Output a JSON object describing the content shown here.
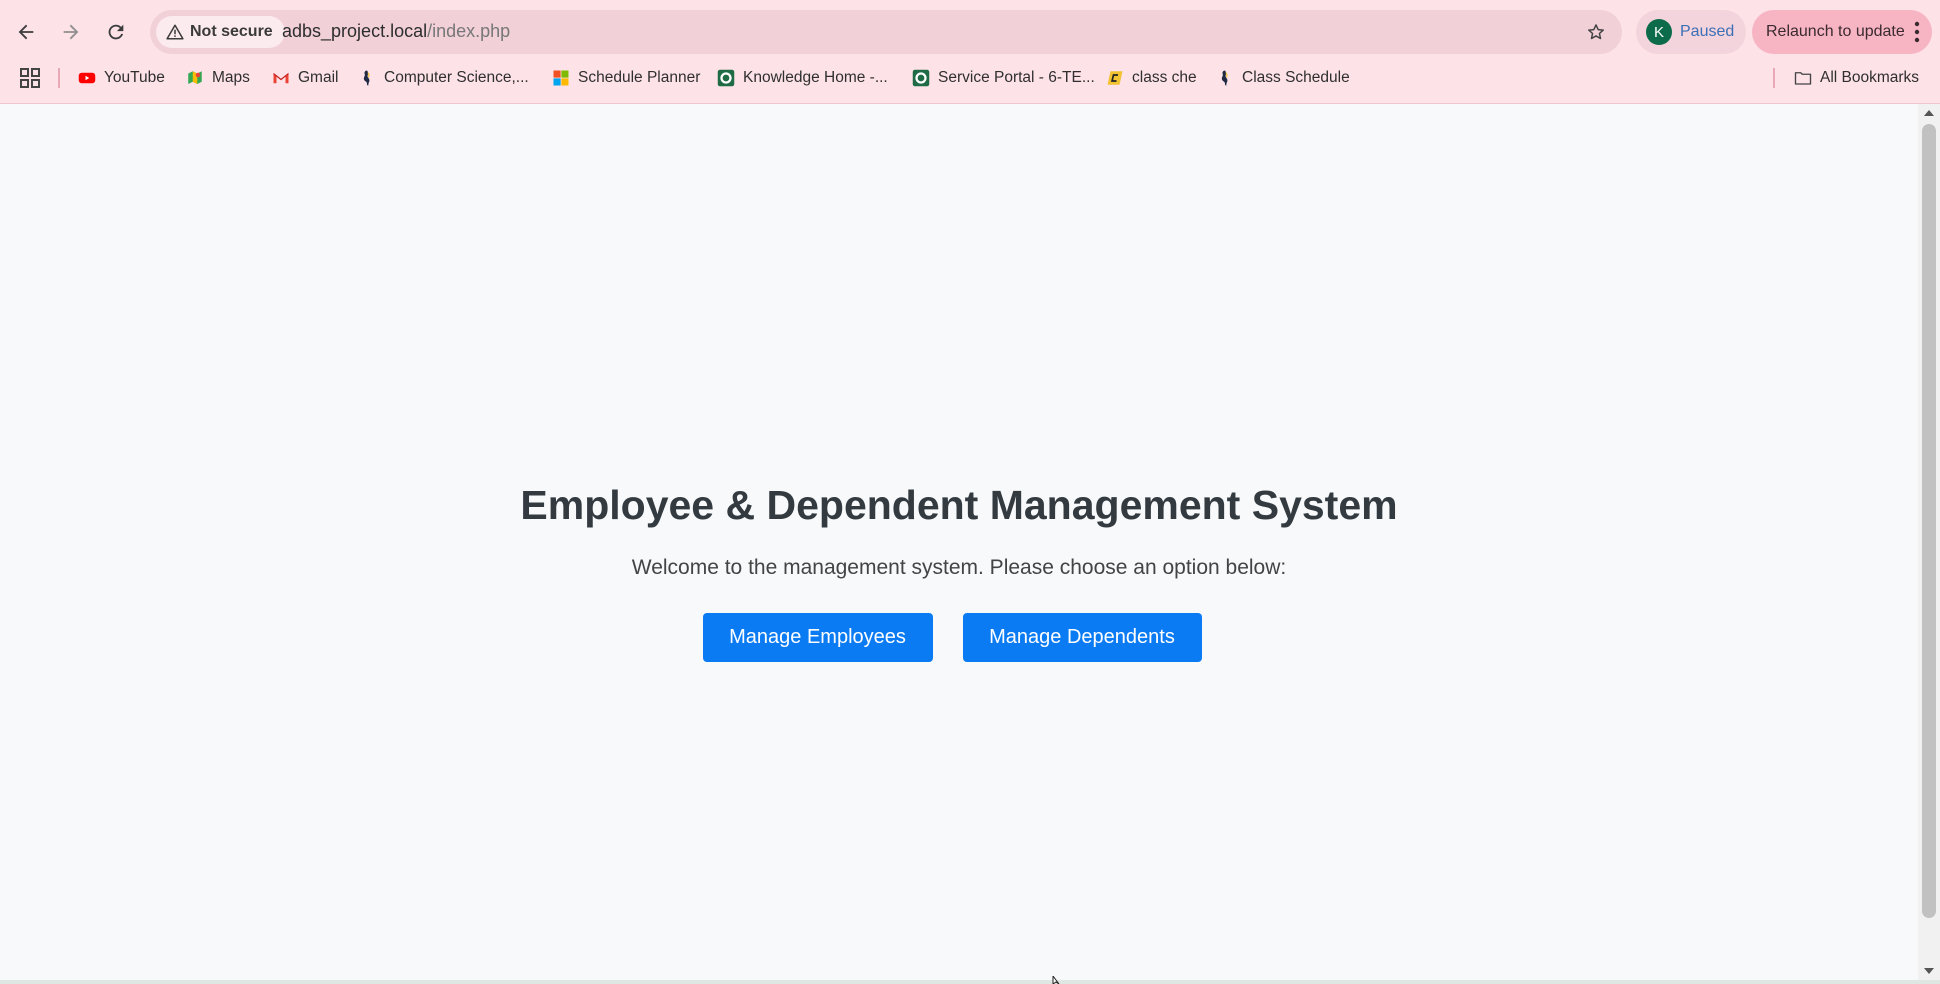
{
  "browser": {
    "security_label": "Not secure",
    "url_host": "adbs_project.local",
    "url_path": "/index.php",
    "profile_initial": "K",
    "profile_status": "Paused",
    "relaunch_label": "Relaunch to update"
  },
  "bookmarks": {
    "items": [
      {
        "label": "YouTube",
        "icon": "youtube-icon"
      },
      {
        "label": "Maps",
        "icon": "maps-icon"
      },
      {
        "label": "Gmail",
        "icon": "gmail-icon"
      },
      {
        "label": "Computer Science,...",
        "icon": "university-icon"
      },
      {
        "label": "Schedule Planner",
        "icon": "microsoft-icon"
      },
      {
        "label": "Knowledge Home -...",
        "icon": "servicenow-icon"
      },
      {
        "label": "Service Portal - 6-TE...",
        "icon": "servicenow-icon"
      },
      {
        "label": "class che",
        "icon": "cheg-icon"
      },
      {
        "label": "Class Schedule",
        "icon": "university-icon"
      }
    ],
    "all_bookmarks_label": "All Bookmarks"
  },
  "page": {
    "title": "Employee & Dependent Management System",
    "subtitle": "Welcome to the management system. Please choose an option below:",
    "buttons": {
      "employees": "Manage Employees",
      "dependents": "Manage Dependents"
    }
  },
  "colors": {
    "chrome_bg": "#fde2e8",
    "button_bg": "#0a7bf3",
    "page_bg": "#f7f9fa"
  }
}
